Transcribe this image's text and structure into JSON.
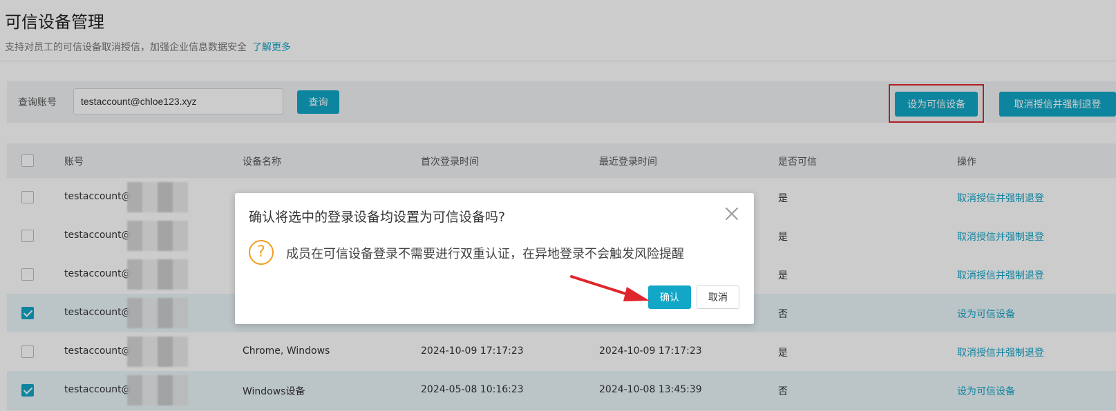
{
  "page": {
    "title": "可信设备管理",
    "subtitle": "支持对员工的可信设备取消授信，加强企业信息数据安全",
    "learn_more": "了解更多"
  },
  "search": {
    "label": "查询账号",
    "value": "testaccount@chloe123.xyz",
    "query_button": "查询"
  },
  "toolbar": {
    "set_trusted": "设为可信设备",
    "revoke": "取消授信并强制退登"
  },
  "table": {
    "headers": [
      "账号",
      "设备名称",
      "首次登录时间",
      "最近登录时间",
      "是否可信",
      "操作"
    ],
    "rows": [
      {
        "account": "testaccount@",
        "device": "",
        "first": "",
        "last": "",
        "trusted": "是",
        "action": "取消授信并强制退登",
        "checked": false
      },
      {
        "account": "testaccount@",
        "device": "",
        "first": "",
        "last": "",
        "trusted": "是",
        "action": "取消授信并强制退登",
        "checked": false
      },
      {
        "account": "testaccount@",
        "device": "",
        "first": "",
        "last": "",
        "trusted": "是",
        "action": "取消授信并强制退登",
        "checked": false
      },
      {
        "account": "testaccount@",
        "device": "",
        "first": "",
        "last": "",
        "trusted": "否",
        "action": "设为可信设备",
        "checked": true
      },
      {
        "account": "testaccount@",
        "device": "Chrome, Windows",
        "first": "2024-10-09 17:17:23",
        "last": "2024-10-09 17:17:23",
        "trusted": "是",
        "action": "取消授信并强制退登",
        "checked": false
      },
      {
        "account": "testaccount@",
        "device": "Windows设备",
        "first": "2024-05-08 10:16:23",
        "last": "2024-10-08 13:45:39",
        "trusted": "否",
        "action": "设为可信设备",
        "checked": true
      }
    ]
  },
  "dialog": {
    "title": "确认将选中的登录设备均设置为可信设备吗?",
    "message": "成员在可信设备登录不需要进行双重认证，在异地登录不会触发风险提醒",
    "warn_glyph": "?",
    "confirm": "确认",
    "cancel": "取消"
  },
  "colors": {
    "accent": "#12a7c6",
    "highlight": "#e0262d",
    "warning": "#f39b1d"
  }
}
